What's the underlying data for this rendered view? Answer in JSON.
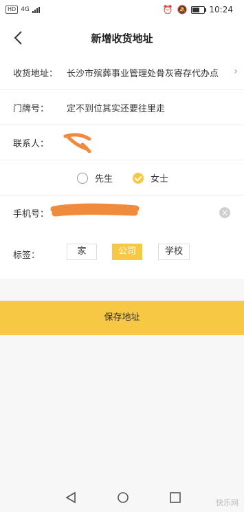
{
  "status_bar": {
    "hd": "HD",
    "network": "4G",
    "time": "10:24"
  },
  "header": {
    "title": "新增收货地址",
    "back_icon": "chevron-left-icon"
  },
  "form": {
    "address": {
      "label": "收货地址：",
      "value": "长沙市殡葬事业管理处骨灰寄存代办点"
    },
    "door_number": {
      "label": "门牌号：",
      "value": "定不到位其实还要往里走"
    },
    "contact": {
      "label": "联系人：",
      "value": ""
    },
    "gender": {
      "options": [
        "先生",
        "女士"
      ],
      "selected": "女士"
    },
    "phone": {
      "label": "手机号：",
      "value": ""
    }
  },
  "tags": {
    "label": "标签：",
    "options": [
      "家",
      "公司",
      "学校"
    ],
    "selected": "公司"
  },
  "save_label": "保存地址",
  "watermark": "快乐网",
  "colors": {
    "accent": "#f7c844",
    "redaction": "#f08a3c"
  }
}
